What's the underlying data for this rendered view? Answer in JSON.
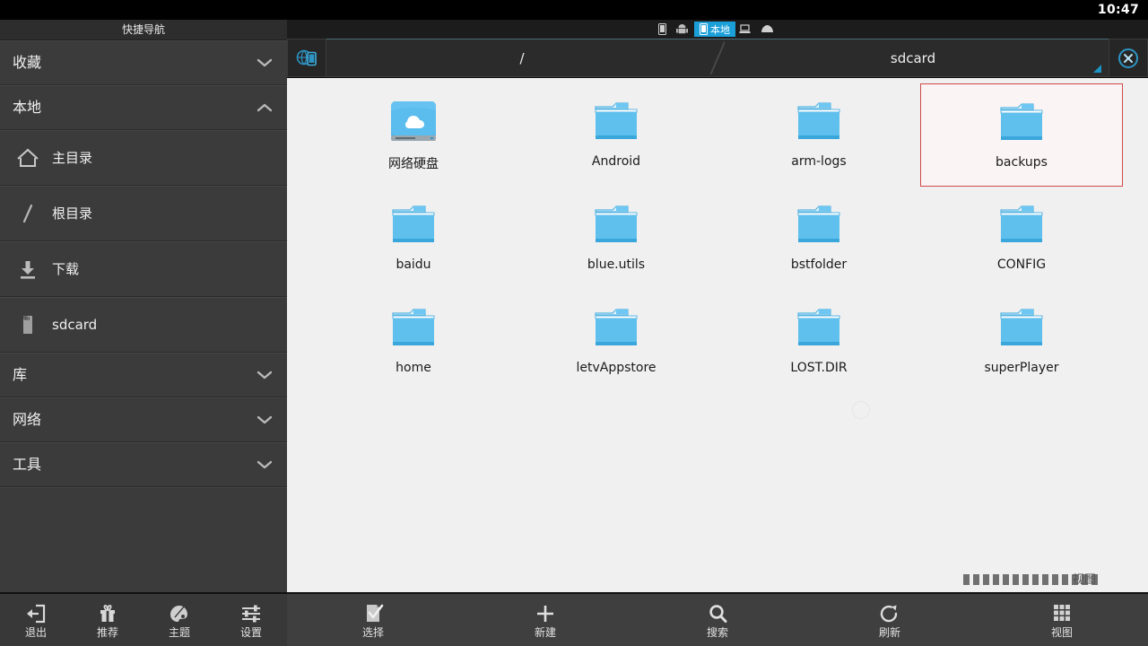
{
  "status_bar": {
    "clock": "10:47"
  },
  "sidebar": {
    "title": "快捷导航",
    "groups": [
      {
        "label": "收藏",
        "state": "collapsed",
        "icon": "chevron-down-icon"
      },
      {
        "label": "本地",
        "state": "expanded",
        "icon": "chevron-up-icon"
      }
    ],
    "items": [
      {
        "label": "主目录",
        "icon": "home-icon"
      },
      {
        "label": "根目录",
        "icon": "slash-root-icon"
      },
      {
        "label": "下载",
        "icon": "download-icon"
      },
      {
        "label": "sdcard",
        "icon": "sdcard-icon"
      }
    ],
    "sections": [
      {
        "label": "库",
        "icon": "chevron-down-icon"
      },
      {
        "label": "网络",
        "icon": "chevron-down-icon"
      },
      {
        "label": "工具",
        "icon": "chevron-down-icon"
      }
    ]
  },
  "left_toolbar": {
    "items": [
      {
        "label": "退出",
        "icon": "exit-door-icon"
      },
      {
        "label": "推荐",
        "icon": "gift-icon"
      },
      {
        "label": "主题",
        "icon": "palette-icon"
      },
      {
        "label": "设置",
        "icon": "sliders-icon"
      }
    ]
  },
  "tabbar": {
    "tabs": [
      {
        "label": "",
        "icon": "phone-icon",
        "active": false
      },
      {
        "label": "",
        "icon": "android-robot-icon",
        "active": false
      },
      {
        "label": "本地",
        "icon": "phone-icon",
        "active": true
      },
      {
        "label": "",
        "icon": "server-icon",
        "active": false
      },
      {
        "label": "",
        "icon": "cloud-icon",
        "active": false
      }
    ],
    "active_color": "#1a9fd9"
  },
  "pathbar": {
    "lead_icon": "globe-device-icon",
    "close_icon": "close-circle-icon",
    "crumbs": [
      {
        "label": "/"
      },
      {
        "label": "sdcard",
        "has_resize_corner": true
      }
    ],
    "accent_color": "#1d93c4"
  },
  "files": {
    "selection_color": "#cf4a4a",
    "items": [
      {
        "name": "网络硬盘",
        "type": "network-drive",
        "selected": false
      },
      {
        "name": "Android",
        "type": "folder",
        "selected": false
      },
      {
        "name": "arm-logs",
        "type": "folder",
        "selected": false
      },
      {
        "name": "backups",
        "type": "folder",
        "selected": true
      },
      {
        "name": "baidu",
        "type": "folder",
        "selected": false
      },
      {
        "name": "blue.utils",
        "type": "folder",
        "selected": false
      },
      {
        "name": "bstfolder",
        "type": "folder",
        "selected": false
      },
      {
        "name": "CONFIG",
        "type": "folder",
        "selected": false
      },
      {
        "name": "home",
        "type": "folder",
        "selected": false
      },
      {
        "name": "letvAppstore",
        "type": "folder",
        "selected": false
      },
      {
        "name": "LOST.DIR",
        "type": "folder",
        "selected": false
      },
      {
        "name": "superPlayer",
        "type": "folder",
        "selected": false
      }
    ]
  },
  "right_toolbar": {
    "items": [
      {
        "label": "选择",
        "icon": "select-check-icon"
      },
      {
        "label": "新建",
        "icon": "plus-icon"
      },
      {
        "label": "搜索",
        "icon": "search-icon"
      },
      {
        "label": "刷新",
        "icon": "refresh-icon"
      },
      {
        "label": "视图",
        "icon": "grid-view-icon"
      }
    ],
    "glitch_label": "视图"
  }
}
